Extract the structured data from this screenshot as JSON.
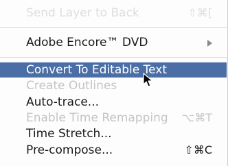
{
  "menu": {
    "items": [
      {
        "label": "Send Layer to Back",
        "shortcut": "⇧⌘[",
        "state": "faded"
      },
      {
        "label": "Adobe Encore™ DVD",
        "submenu": true
      },
      {
        "label": "Convert To Editable Text",
        "state": "selected"
      },
      {
        "label": "Create Outlines",
        "state": "disabled"
      },
      {
        "label": "Auto-trace..."
      },
      {
        "label": "Enable Time Remapping",
        "shortcut": "⌥⌘T",
        "state": "disabled"
      },
      {
        "label": "Time Stretch..."
      },
      {
        "label": "Pre-compose...",
        "shortcut": "⇧⌘C"
      }
    ]
  },
  "cursor": {
    "icon": "arrow-pointer-icon"
  }
}
